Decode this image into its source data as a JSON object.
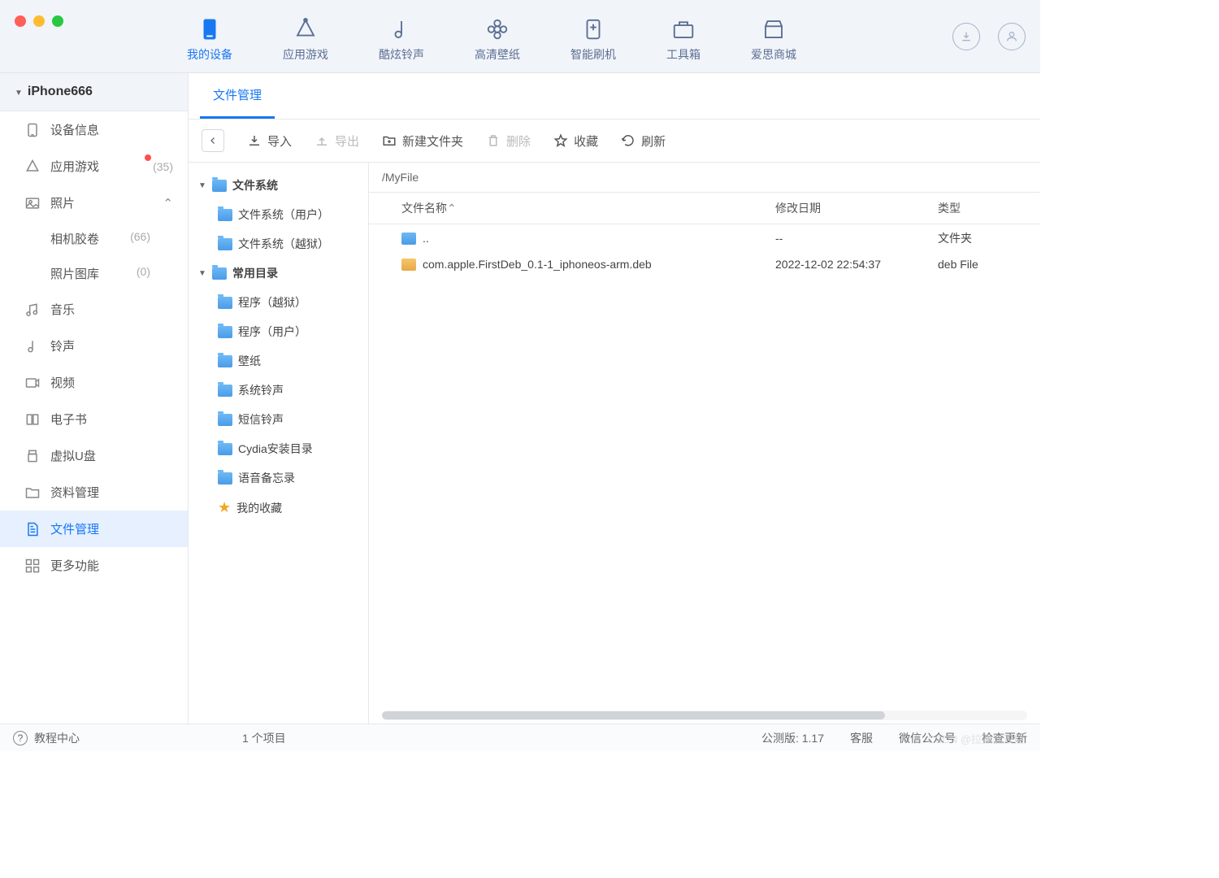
{
  "nav": {
    "items": [
      {
        "label": "我的设备",
        "active": true
      },
      {
        "label": "应用游戏"
      },
      {
        "label": "酷炫铃声"
      },
      {
        "label": "高清壁纸"
      },
      {
        "label": "智能刷机"
      },
      {
        "label": "工具箱"
      },
      {
        "label": "爱思商城"
      }
    ]
  },
  "sidebar": {
    "device": "iPhone666",
    "items": [
      {
        "label": "设备信息"
      },
      {
        "label": "应用游戏",
        "count": "(35)",
        "dot": true
      },
      {
        "label": "照片",
        "expanded": true,
        "children": [
          {
            "label": "相机胶卷",
            "count": "(66)"
          },
          {
            "label": "照片图库",
            "count": "(0)"
          }
        ]
      },
      {
        "label": "音乐"
      },
      {
        "label": "铃声"
      },
      {
        "label": "视频"
      },
      {
        "label": "电子书"
      },
      {
        "label": "虚拟U盘"
      },
      {
        "label": "资料管理"
      },
      {
        "label": "文件管理",
        "active": true
      },
      {
        "label": "更多功能"
      }
    ]
  },
  "content": {
    "tab": "文件管理",
    "toolbar": {
      "import": "导入",
      "export": "导出",
      "newfolder": "新建文件夹",
      "delete": "删除",
      "favorite": "收藏",
      "refresh": "刷新"
    },
    "tree": [
      {
        "label": "文件系统",
        "lvl": 0,
        "arrow": "▼"
      },
      {
        "label": "文件系统（用户）",
        "lvl": 1
      },
      {
        "label": "文件系统（越狱）",
        "lvl": 1
      },
      {
        "label": "常用目录",
        "lvl": 0,
        "arrow": "▼"
      },
      {
        "label": "程序（越狱）",
        "lvl": 1
      },
      {
        "label": "程序（用户）",
        "lvl": 1
      },
      {
        "label": "壁纸",
        "lvl": 1
      },
      {
        "label": "系统铃声",
        "lvl": 1
      },
      {
        "label": "短信铃声",
        "lvl": 1
      },
      {
        "label": "Cydia安装目录",
        "lvl": 1
      },
      {
        "label": "语音备忘录",
        "lvl": 1
      },
      {
        "label": "我的收藏",
        "lvl": 1,
        "star": true
      }
    ],
    "breadcrumb": "/MyFile",
    "columns": {
      "name": "文件名称",
      "date": "修改日期",
      "type": "类型"
    },
    "rows": [
      {
        "name": "..",
        "date": "--",
        "type": "文件夹",
        "icon": "folder"
      },
      {
        "name": "com.apple.FirstDeb_0.1-1_iphoneos-arm.deb",
        "date": "2022-12-02 22:54:37",
        "type": "deb File",
        "icon": "deb"
      }
    ]
  },
  "status": {
    "help": "教程中心",
    "items_count": "1 个项目",
    "version": "公测版: 1.17",
    "support": "客服",
    "wechat": "微信公众号",
    "update": "检查更新"
  },
  "watermark": "CSDN @拉黑猫双仙"
}
